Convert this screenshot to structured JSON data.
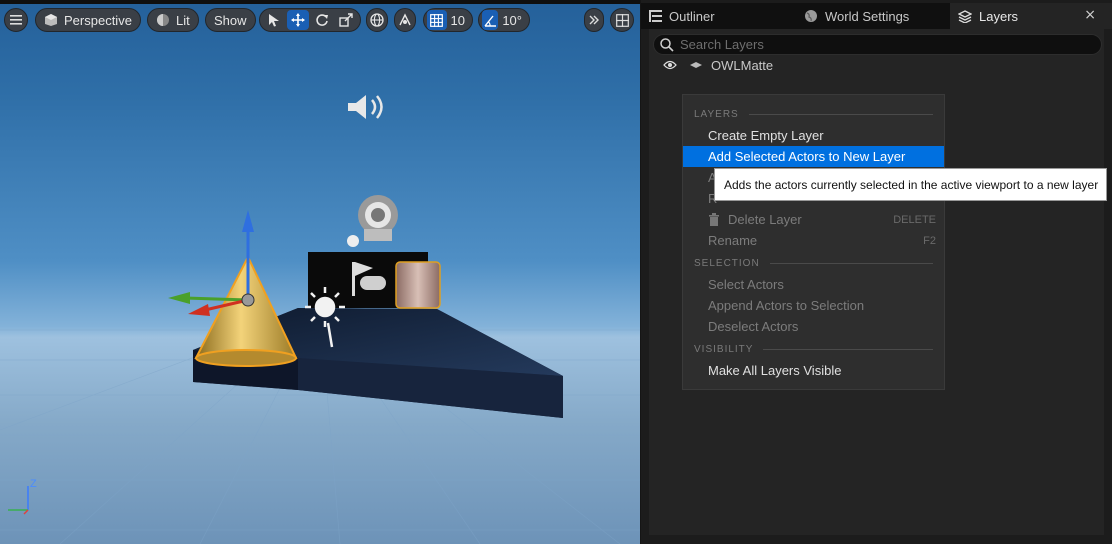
{
  "viewport": {
    "menu_icon": "hamburger-icon",
    "perspective_label": "Perspective",
    "lit_label": "Lit",
    "show_label": "Show",
    "grid_snap_value": "10",
    "rotation_snap_value": "10°",
    "axis_label": "Z"
  },
  "panel": {
    "tabs": [
      {
        "label": "Outliner",
        "icon": "outliner-icon"
      },
      {
        "label": "World Settings",
        "icon": "globe-icon"
      },
      {
        "label": "Layers",
        "icon": "layers-icon"
      }
    ],
    "close_label": "×",
    "search_placeholder": "Search Layers",
    "layers": [
      {
        "name": "OWLMatte",
        "visible": true
      }
    ]
  },
  "context_menu": {
    "sections": [
      {
        "title": "LAYERS",
        "items": [
          {
            "label": "Create Empty Layer",
            "state": "enabled"
          },
          {
            "label": "Add Selected Actors to New Layer",
            "state": "highlighted"
          },
          {
            "label": "A",
            "state": "disabled"
          },
          {
            "label": "R",
            "state": "disabled"
          },
          {
            "label": "Delete Layer",
            "state": "disabled",
            "shortcut": "DELETE",
            "icon": "trash-icon"
          },
          {
            "label": "Rename",
            "state": "disabled",
            "shortcut": "F2"
          }
        ]
      },
      {
        "title": "SELECTION",
        "items": [
          {
            "label": "Select Actors",
            "state": "disabled"
          },
          {
            "label": "Append Actors to Selection",
            "state": "disabled"
          },
          {
            "label": "Deselect Actors",
            "state": "disabled"
          }
        ]
      },
      {
        "title": "VISIBILITY",
        "items": [
          {
            "label": "Make All Layers Visible",
            "state": "enabled"
          }
        ]
      }
    ]
  },
  "tooltip": {
    "text": "Adds the actors currently selected in the active viewport to a new layer"
  },
  "colors": {
    "highlight": "#0070e0",
    "active_tool": "#1a5fb4",
    "panel_bg": "#242424"
  }
}
